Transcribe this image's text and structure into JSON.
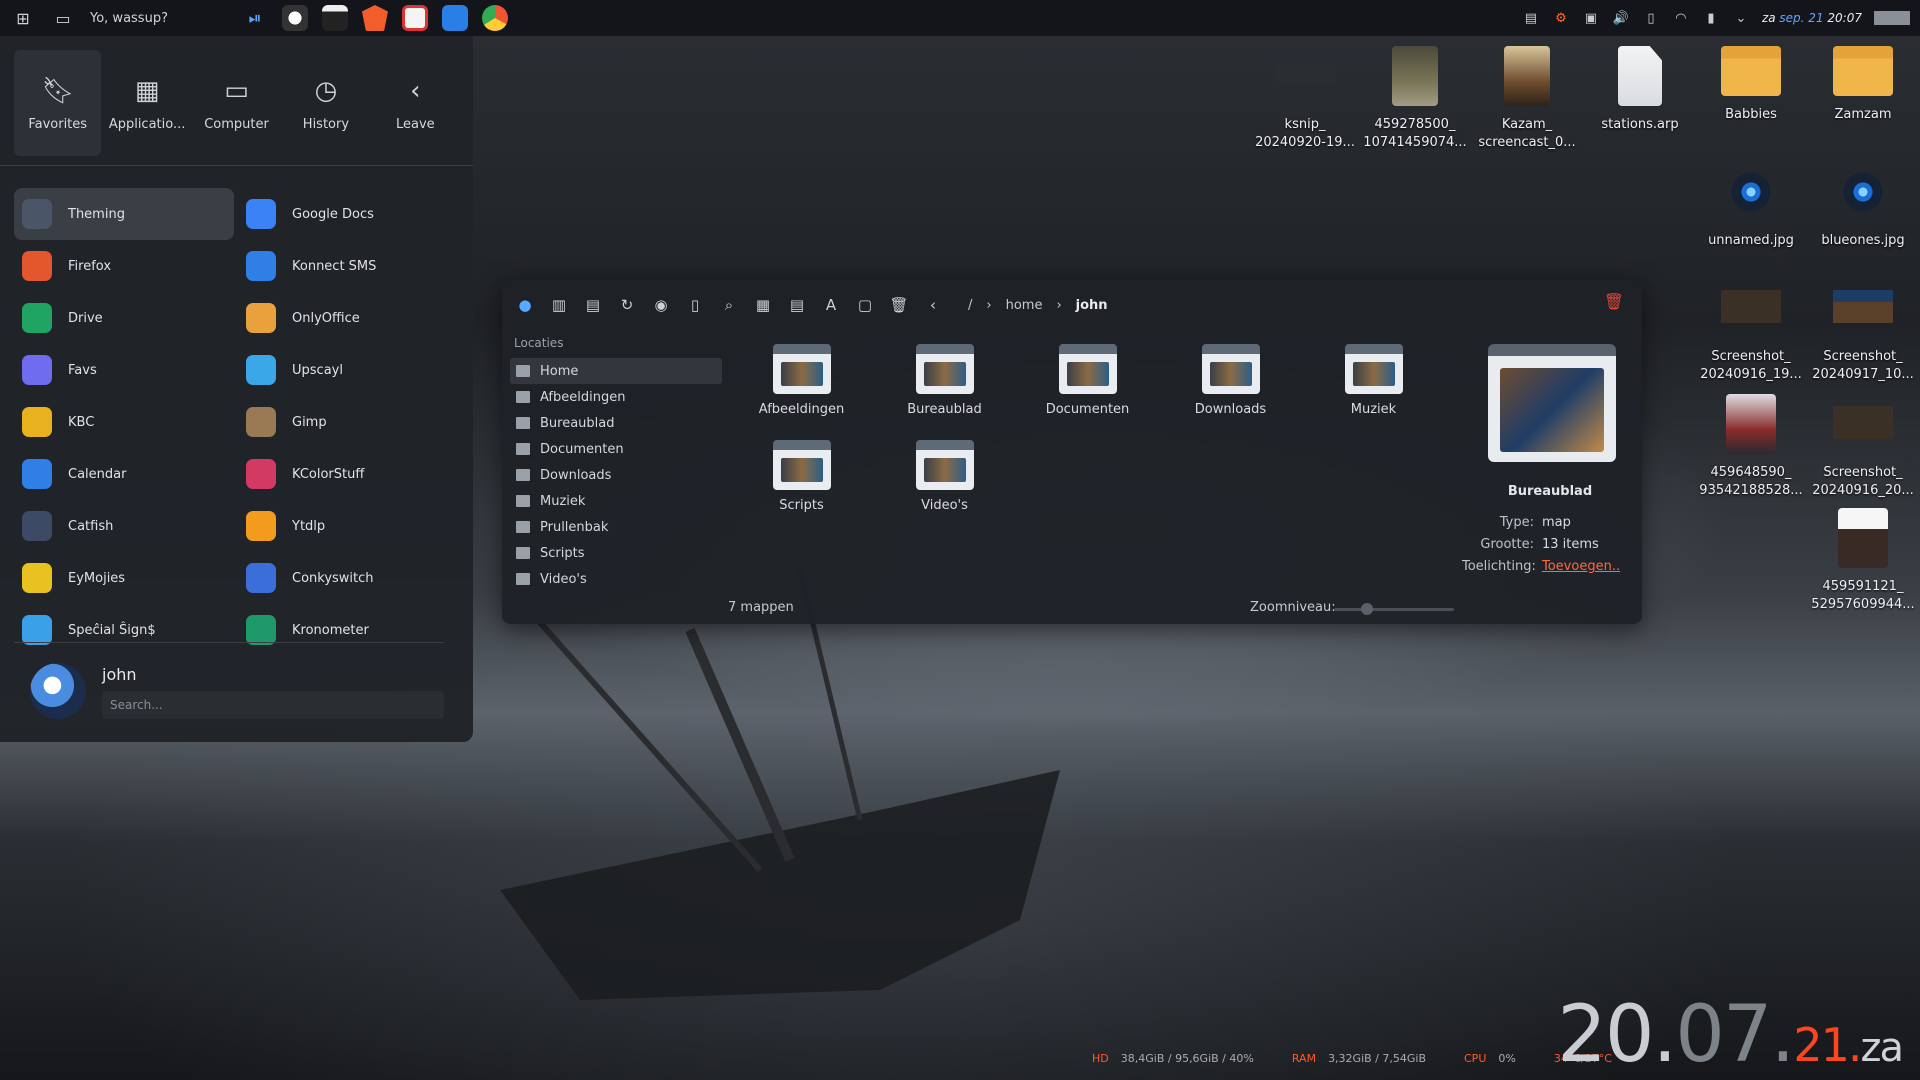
{
  "top_panel": {
    "greeting": "Yo, wassup?",
    "date_day": "za",
    "date_month": "sep. 21",
    "time": "20:07"
  },
  "launcher": {
    "tabs": [
      {
        "label": "Favorites",
        "icon": "bookmark-icon"
      },
      {
        "label": "Applicatio...",
        "icon": "grid-icon"
      },
      {
        "label": "Computer",
        "icon": "monitor-icon"
      },
      {
        "label": "History",
        "icon": "clock-icon"
      },
      {
        "label": "Leave",
        "icon": "back-icon"
      }
    ],
    "apps": [
      {
        "label": "Theming",
        "color": "#4a5668"
      },
      {
        "label": "Google Docs",
        "color": "#3b82f6"
      },
      {
        "label": "Firefox",
        "color": "#e4572e"
      },
      {
        "label": "Konnect SMS",
        "color": "#2f7fe6"
      },
      {
        "label": "Drive",
        "color": "#1fa463"
      },
      {
        "label": "OnlyOffice",
        "color": "#e9a23b"
      },
      {
        "label": "Favs",
        "color": "#6f6cf0"
      },
      {
        "label": "Upscayl",
        "color": "#3aa8e8"
      },
      {
        "label": "KBC",
        "color": "#e8b21e"
      },
      {
        "label": "Gimp",
        "color": "#9a7a55"
      },
      {
        "label": "Calendar",
        "color": "#2f7fe6"
      },
      {
        "label": "KColorStuff",
        "color": "#d23a64"
      },
      {
        "label": "Catfish",
        "color": "#3c4a66"
      },
      {
        "label": "Ytdlp",
        "color": "#f39b1c"
      },
      {
        "label": "EyMojies",
        "color": "#e8c21e"
      },
      {
        "label": "Conkyswitch",
        "color": "#3b6ed8"
      },
      {
        "label": "Speĉial Ŝign$",
        "color": "#3aa0e8"
      },
      {
        "label": "Kronometer",
        "color": "#1e9a6a"
      }
    ],
    "user_name": "john",
    "search_placeholder": "Search..."
  },
  "file_manager": {
    "breadcrumb": [
      "/",
      "home",
      "john"
    ],
    "sidebar_title": "Locaties",
    "sidebar": [
      "Home",
      "Afbeeldingen",
      "Bureaublad",
      "Documenten",
      "Downloads",
      "Muziek",
      "Prullenbak",
      "Scripts",
      "Video's"
    ],
    "folders": [
      "Afbeeldingen",
      "Bureaublad",
      "Documenten",
      "Downloads",
      "Muziek",
      "Scripts",
      "Video's"
    ],
    "status": "7 mappen",
    "zoom_label": "Zoomniveau:",
    "zoom_value": 0.25,
    "info": {
      "name": "Bureaublad",
      "type_key": "Type:",
      "type_val": "map",
      "size_key": "Grootte:",
      "size_val": "13 items",
      "note_key": "Toelichting:",
      "note_val": "Toevoegen.."
    }
  },
  "desktop": [
    {
      "label": "ksnip_\n20240920-19...",
      "thumb": "t-dark"
    },
    {
      "label": "459278500_\n10741459074...",
      "thumb": "t-photo1"
    },
    {
      "label": "Kazam_\nscreencast_0...",
      "thumb": "t-photo2"
    },
    {
      "label": "stations.arp",
      "thumb": "t-doc"
    },
    {
      "label": "Babbies",
      "thumb": "t-folder"
    },
    {
      "label": "Zamzam",
      "thumb": "t-folder"
    },
    {
      "label": "unnamed.jpg",
      "thumb": "t-eye"
    },
    {
      "label": "blueones.jpg",
      "thumb": "t-eye"
    },
    {
      "label": "Screenshot_\n20240916_19...",
      "thumb": "t-shot"
    },
    {
      "label": "Screenshot_\n20240917_10...",
      "thumb": "t-shot2"
    },
    {
      "label": "459648590_\n93542188528...",
      "thumb": "t-port"
    },
    {
      "label": "Screenshot_\n20240916_20...",
      "thumb": "t-shot"
    },
    {
      "label": "459591121_\n52957609944...",
      "thumb": "t-page"
    }
  ],
  "stats": {
    "hd_label": "HD",
    "hd_val": "38,4GiB / 95,6GiB / 40%",
    "ram_label": "RAM",
    "ram_val": "3,32GiB / 7,54GiB",
    "cpu_label": "CPU",
    "cpu_val": "0%",
    "temp": "34°C/27°C"
  },
  "clock": {
    "a": "20",
    "dot1": ".",
    "b": "07",
    "dot2": ".",
    "c": "21",
    "dot3": ".",
    "e": "za"
  },
  "colors": {
    "accent": "#5aa8ff",
    "orange": "#ff5a2a"
  }
}
